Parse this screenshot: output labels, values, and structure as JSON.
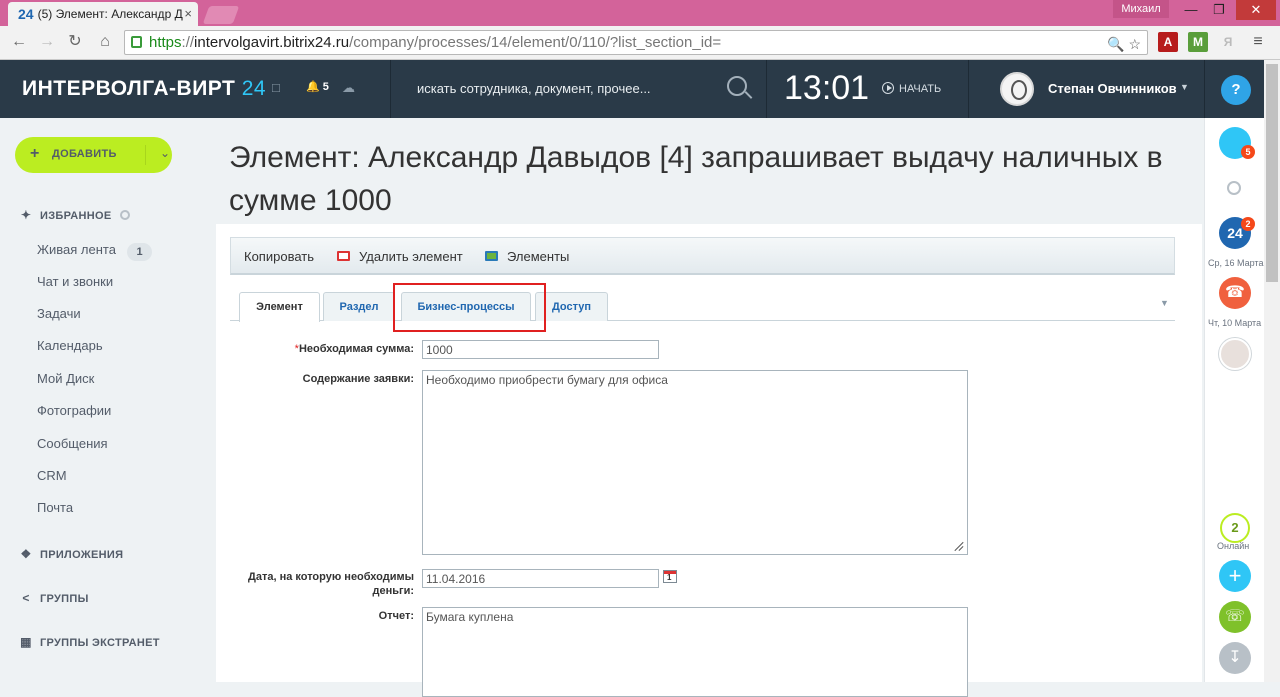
{
  "browser": {
    "tab_logo": "24",
    "tab_title": "(5) Элемент: Александр Д",
    "tab_close": "×",
    "window_user": "Михаил",
    "url_https": "https",
    "url_sep": "://",
    "url_host": "intervolgavirt.bitrix24.ru",
    "url_path": "/company/processes/14/element/0/110/?list_section_id="
  },
  "header": {
    "logo_text": "ИНТЕРВОЛГА-ВИРТ",
    "logo_num": "24",
    "notifications_count": "5",
    "search_placeholder": "искать сотрудника, документ, прочее...",
    "clock": "13:01",
    "start_label": "НАЧАТЬ",
    "user_name": "Степан Овчинников",
    "help_label": "?"
  },
  "sidebar": {
    "add_button": "ДОБАВИТЬ",
    "favorites": "ИЗБРАННОЕ",
    "items": [
      {
        "label": "Живая лента",
        "counter": "1"
      },
      {
        "label": "Чат и звонки"
      },
      {
        "label": "Задачи"
      },
      {
        "label": "Календарь"
      },
      {
        "label": "Мой Диск"
      },
      {
        "label": "Фотографии"
      },
      {
        "label": "Сообщения"
      },
      {
        "label": "CRM"
      },
      {
        "label": "Почта"
      }
    ],
    "sections": [
      "ПРИЛОЖЕНИЯ",
      "ГРУППЫ",
      "ГРУППЫ ЭКСТРАНЕТ"
    ]
  },
  "page": {
    "title": "Элемент: Александр Давыдов [4] запрашивает выдачу наличных в сумме 1000"
  },
  "toolbar": {
    "copy": "Копировать",
    "delete": "Удалить элемент",
    "elements": "Элементы"
  },
  "tabs": [
    {
      "label": "Элемент",
      "active": true
    },
    {
      "label": "Раздел"
    },
    {
      "label": "Бизнес-процессы",
      "highlighted": true
    },
    {
      "label": "Доступ"
    }
  ],
  "form": {
    "required_mark": "*",
    "amount_label": "Необходимая сумма:",
    "amount_value": "1000",
    "request_label": "Содержание заявки:",
    "request_value": "Необходимо приобрести бумагу для офиса",
    "date_label": "Дата, на которую необходимы деньги:",
    "date_value": "11.04.2016",
    "report_label": "Отчет:",
    "report_value": "Бумага куплена"
  },
  "right_panel": {
    "notif_badge": "5",
    "b24_badge": "2",
    "date1": "Ср, 16 Марта",
    "date2": "Чт, 10 Марта",
    "online_count": "2",
    "online_label": "Онлайн"
  },
  "colors": {
    "accent": "#2fc6f6",
    "add_button": "#bbed21",
    "header_bg": "#2a3a48",
    "highlight": "#e02020"
  }
}
